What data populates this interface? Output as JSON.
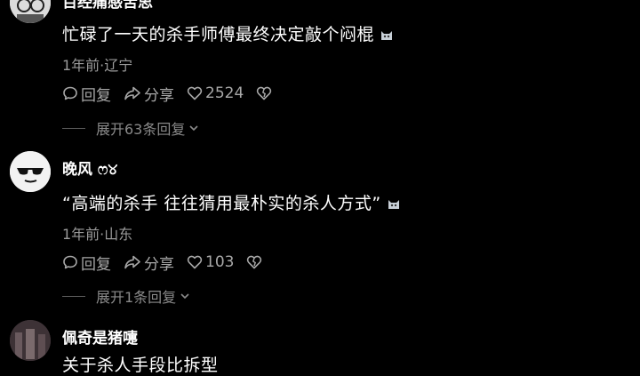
{
  "comments": [
    {
      "username": "百经痛感苦思",
      "content": "忙碌了一天的杀手师傅最终决定敲个闷棍",
      "meta": "1年前·辽宁",
      "reply_label": "回复",
      "share_label": "分享",
      "like_count": "2524",
      "expand_label": "展开63条回复"
    },
    {
      "username": "晚风 ෆ୪",
      "content": "“高端的杀手  往往猜用最朴实的杀人方式”",
      "meta": "1年前·山东",
      "reply_label": "回复",
      "share_label": "分享",
      "like_count": "103",
      "expand_label": "展开1条回复"
    },
    {
      "username": "佩奇是猪嚏",
      "content": "关于杀人手段比拆型"
    }
  ],
  "icons": {
    "reply": "speech-bubble-icon",
    "share": "share-arrow-icon",
    "like": "heart-icon",
    "dislike": "broken-heart-icon",
    "expand": "chevron-down-icon",
    "sticker": "cat-sticker-icon"
  },
  "colors": {
    "background": "#000000",
    "text": "#ffffff",
    "muted": "#9a9a9a"
  }
}
